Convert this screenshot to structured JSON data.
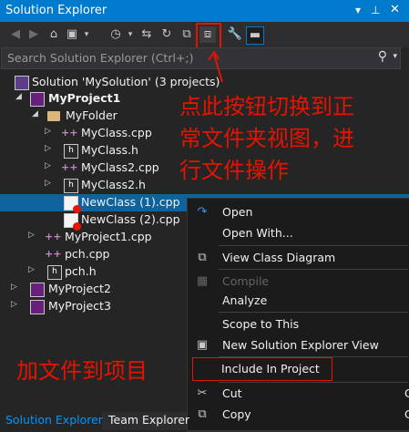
{
  "window": {
    "title": "Solution Explorer"
  },
  "search": {
    "placeholder": "Search Solution Explorer (Ctrl+;)"
  },
  "tree": {
    "solution": "Solution 'MySolution' (3 projects)",
    "project1": "MyProject1",
    "folder": "MyFolder",
    "items": [
      "MyClass.cpp",
      "MyClass.h",
      "MyClass2.cpp",
      "MyClass2.h",
      "NewClass (1).cpp",
      "NewClass (2).cpp"
    ],
    "project1_cpp": "MyProject1.cpp",
    "pch_cpp": "pch.cpp",
    "pch_h": "pch.h",
    "project2": "MyProject2",
    "project3": "MyProject3"
  },
  "annotations": {
    "toggle_note_line1": "点此按钮切换到正",
    "toggle_note_line2": "常文件夹视图，进",
    "toggle_note_line3": "行文件操作",
    "include_note": "加文件到项目"
  },
  "context_menu": {
    "open": "Open",
    "open_with": "Open With...",
    "view_class_diagram": "View Class Diagram",
    "compile": "Compile",
    "analyze": "Analyze",
    "scope_to_this": "Scope to This",
    "new_view": "New Solution Explorer View",
    "include_in_project": "Include In Project",
    "cut": "Cut",
    "copy": "Copy",
    "cut_short": "C",
    "copy_short": "C"
  },
  "tabs": {
    "solution_explorer": "Solution Explorer",
    "team_explorer": "Team Explorer"
  },
  "colors": {
    "accent": "#007acc",
    "annotation_red": "#e51400",
    "selection": "#0e639c"
  }
}
